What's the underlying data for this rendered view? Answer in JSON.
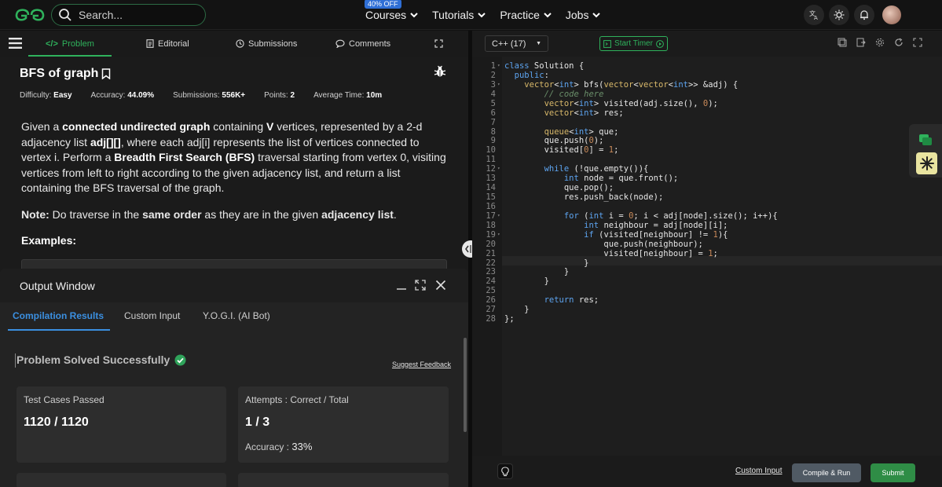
{
  "nav": {
    "search_placeholder": "Search...",
    "links": [
      {
        "label": "Courses",
        "badge": "40% OFF"
      },
      {
        "label": "Tutorials"
      },
      {
        "label": "Practice"
      },
      {
        "label": "Jobs"
      }
    ]
  },
  "left_tabs": {
    "problem": "Problem",
    "editorial": "Editorial",
    "submissions": "Submissions",
    "comments": "Comments"
  },
  "problem": {
    "title": "BFS of graph",
    "meta": {
      "difficulty_label": "Difficulty:",
      "difficulty": "Easy",
      "accuracy_label": "Accuracy:",
      "accuracy": "44.09%",
      "submissions_label": "Submissions:",
      "submissions": "556K+",
      "points_label": "Points:",
      "points": "2",
      "avg_time_label": "Average Time:",
      "avg_time": "10m"
    },
    "desc": {
      "p1": "Given a ",
      "b1": "connected undirected graph",
      "p2": " containing ",
      "b2": "V",
      "p3": " vertices, represented by a 2-d adjacency list ",
      "b3": "adj[][]",
      "p4": ", where each adj[i] represents the list of vertices connected to vertex i. Perform a ",
      "b4": "Breadth First Search (BFS)",
      "p5": " traversal starting from vertex 0, visiting vertices from left to right according to the given adjacency list, and return a list containing the BFS traversal of the graph."
    },
    "note": {
      "b1": "Note:",
      "p1": " Do traverse in the ",
      "b2": "same order",
      "p2": " as they are in the given ",
      "b3": "adjacency list",
      "p3": "."
    },
    "examples_label": "Examples:"
  },
  "output": {
    "title": "Output Window",
    "tabs": [
      "Compilation Results",
      "Custom Input",
      "Y.O.G.I. (AI Bot)"
    ],
    "status": "Problem Solved Successfully",
    "suggest_feedback": "Suggest Feedback",
    "test_cases_label": "Test Cases Passed",
    "test_cases_value": "1120 / 1120",
    "attempts_label": "Attempts : Correct / Total",
    "attempts_value": "1 / 3",
    "accuracy_label": "Accuracy :",
    "accuracy_value": "33%"
  },
  "editor": {
    "language": "C++ (17)",
    "timer": "Start Timer",
    "lines": [
      "class Solution {",
      "  public:",
      "    vector<int> bfs(vector<vector<int>> &adj) {",
      "        // code here",
      "        vector<int> visited(adj.size(), 0);",
      "        vector<int> res;",
      "",
      "        queue<int> que;",
      "        que.push(0);",
      "        visited[0] = 1;",
      "",
      "        while (!que.empty()){",
      "            int node = que.front();",
      "            que.pop();",
      "            res.push_back(node);",
      "",
      "            for (int i = 0; i < adj[node].size(); i++){",
      "                int neighbour = adj[node][i];",
      "                if (visited[neighbour] != 1){",
      "                    que.push(neighbour);",
      "                    visited[neighbour] = 1;",
      "                }",
      "            }",
      "        }",
      "",
      "        return res;",
      "    }",
      "};"
    ],
    "custom_input": "Custom Input",
    "compile_run": "Compile & Run",
    "submit": "Submit"
  },
  "colors": {
    "accent_green": "#2fb25c",
    "tab_blue": "#3b8fe0",
    "submit_green": "#2f8d46"
  }
}
